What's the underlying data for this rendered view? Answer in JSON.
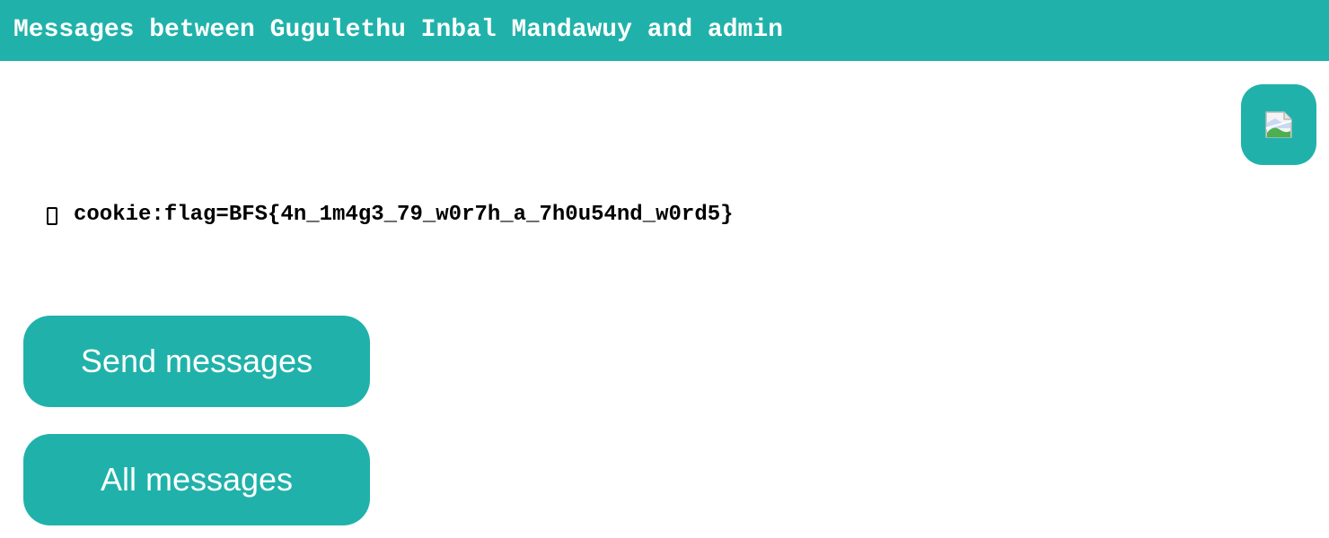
{
  "header": {
    "title": "Messages between Gugulethu Inbal Mandawuy and admin"
  },
  "avatar": {
    "icon": "broken-image-icon",
    "color": "#20b2aa"
  },
  "message": {
    "text": "cookie:flag=BFS{4n_1m4g3_79_w0r7h_a_7h0u54nd_w0rd5}",
    "leading_icon": "missing-glyph-icon"
  },
  "actions": {
    "send_label": "Send messages",
    "all_label": "All messages"
  },
  "theme": {
    "accent": "#20b2aa",
    "text_on_accent": "#ffffff",
    "text": "#000000"
  }
}
